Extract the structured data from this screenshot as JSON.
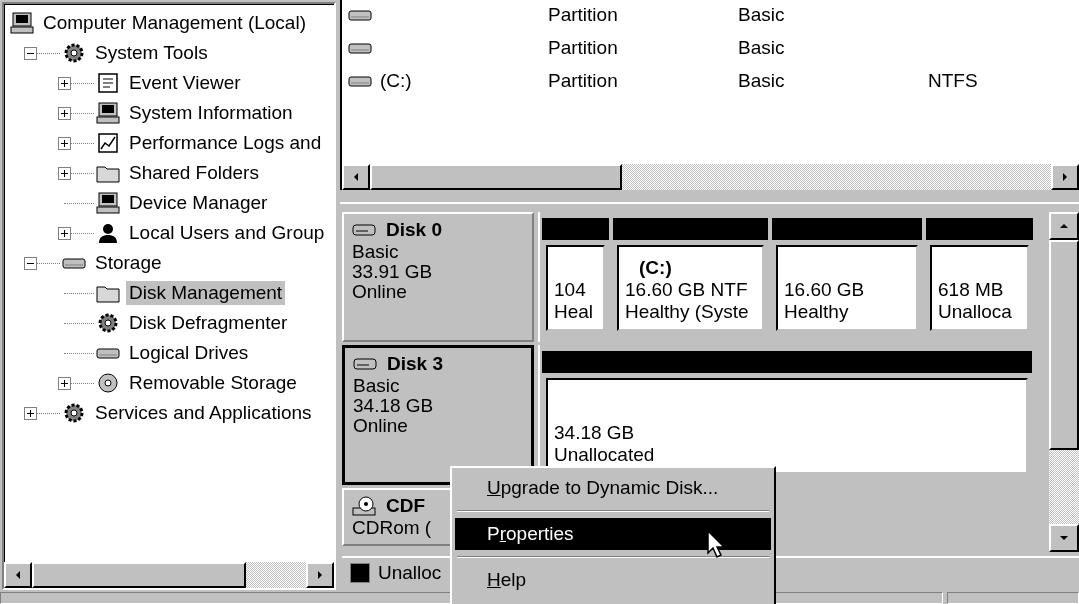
{
  "tree": [
    {
      "label": "Computer Management (Local)",
      "kind": "computer",
      "selected": false,
      "children": [
        {
          "label": "System Tools",
          "kind": "gear",
          "expanded": true,
          "selected": false,
          "children": [
            {
              "label": "Event Viewer",
              "kind": "document",
              "expanded": false,
              "selected": false
            },
            {
              "label": "System Information",
              "kind": "computer",
              "expanded": false,
              "selected": false
            },
            {
              "label": "Performance Logs and",
              "kind": "chart",
              "expanded": false,
              "selected": false
            },
            {
              "label": "Shared Folders",
              "kind": "folder",
              "expanded": false,
              "selected": false
            },
            {
              "label": "Device Manager",
              "kind": "computer",
              "selected": false
            },
            {
              "label": "Local Users and Group",
              "kind": "person",
              "expanded": false,
              "selected": false
            }
          ]
        },
        {
          "label": "Storage",
          "kind": "drive",
          "expanded": true,
          "selected": false,
          "children": [
            {
              "label": "Disk Management",
              "kind": "folder",
              "selected": true
            },
            {
              "label": "Disk Defragmenter",
              "kind": "gear",
              "selected": false
            },
            {
              "label": "Logical Drives",
              "kind": "drive",
              "selected": false
            },
            {
              "label": "Removable Storage",
              "kind": "disc",
              "expanded": false,
              "selected": false
            }
          ]
        },
        {
          "label": "Services and Applications",
          "kind": "gear",
          "expanded": false,
          "selected": false
        }
      ]
    }
  ],
  "volumes": [
    {
      "layout": "Partition",
      "type": "Basic"
    },
    {
      "layout": "Partition",
      "type": "Basic"
    },
    {
      "volume": "(C:)",
      "layout": "Partition",
      "type": "Basic",
      "file_system": "NTFS"
    }
  ],
  "disks": [
    {
      "kind": "disk",
      "name": "Disk 0",
      "type": "Basic",
      "size": "33.91 GB",
      "status": "Online",
      "selected": false,
      "partitions": [
        {
          "size": "104",
          "status": "Heal"
        },
        {
          "label": "(C:)",
          "size": "16.60 GB NTF",
          "status": "Healthy (Syste"
        },
        {
          "size": "16.60 GB",
          "status": "Healthy"
        },
        {
          "size": "618 MB",
          "status": "Unalloca"
        }
      ]
    },
    {
      "kind": "disk",
      "name": "Disk 3",
      "type": "Basic",
      "size": "34.18 GB",
      "status": "Online",
      "selected": true,
      "partitions": [
        {
          "size": "34.18 GB",
          "status": "Unallocated"
        }
      ]
    },
    {
      "kind": "cdrom",
      "name": "CDF",
      "type": "CDRom (",
      "selected": false
    }
  ],
  "legend": [
    {
      "label": "Unalloc",
      "color": "#000000"
    }
  ],
  "context_menu": [
    {
      "kind": "item",
      "key": "U",
      "rest": "pgrade to Dynamic Disk...",
      "selected": false
    },
    {
      "kind": "separator"
    },
    {
      "kind": "item",
      "lead": "P",
      "key": "r",
      "rest": "operties",
      "selected": true
    },
    {
      "kind": "separator"
    },
    {
      "kind": "item",
      "key": "H",
      "rest": "elp",
      "selected": false
    }
  ]
}
